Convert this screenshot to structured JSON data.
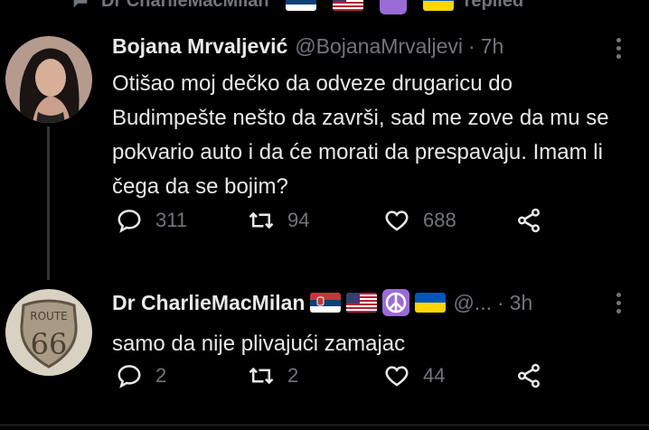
{
  "context": {
    "name": "Dr CharlieMacMilan",
    "replied_label": "replied"
  },
  "tweets": [
    {
      "name": "Bojana Mrvaljević",
      "handle": "@BojanaMrvaljevi",
      "separator": "·",
      "time": "7h",
      "text": "Otišao moj dečko da odveze drugaricu do Budimpešte nešto da završi, sad me zove da mu se pokvario auto i da će morati da prespavaju. Imam li čega da se bojim?",
      "replies": "311",
      "retweets": "94",
      "likes": "688"
    },
    {
      "name": "Dr CharlieMacMilan",
      "handle": "@...",
      "separator": "·",
      "time": "3h",
      "text": "samo da nije plivajući zamajac",
      "replies": "2",
      "retweets": "2",
      "likes": "44",
      "avatar_text_top": "ROUTE",
      "avatar_text_num": "66"
    }
  ],
  "icons": [
    "reply-icon",
    "retweet-icon",
    "like-icon",
    "share-icon",
    "more-icon"
  ],
  "colors": {
    "background": "#000000",
    "text": "#e7e9ea",
    "muted": "#71767b",
    "peace": "#9b6bd6"
  }
}
